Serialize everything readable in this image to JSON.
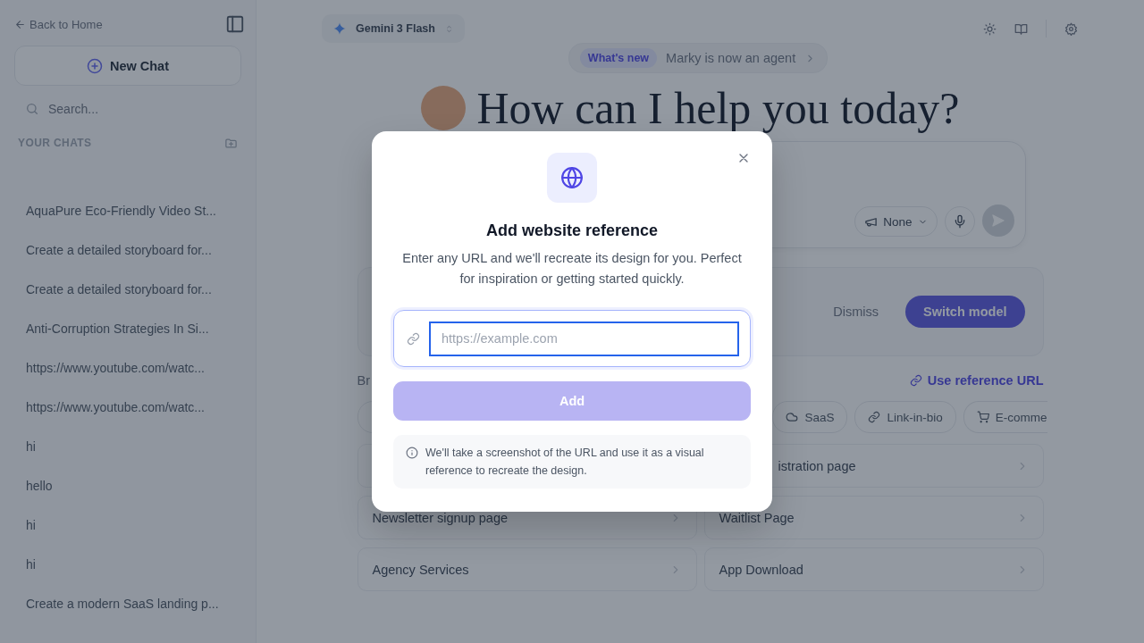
{
  "sidebar": {
    "back_link": "Back to Home",
    "new_chat": "New Chat",
    "search": {
      "placeholder": "Search..."
    },
    "section_title": "YOUR CHATS",
    "chats": [
      "AquaPure Eco-Friendly Video St...",
      "Create a detailed storyboard for...",
      "Create a detailed storyboard for...",
      "Anti-Corruption Strategies In Si...",
      "https://www.youtube.com/watc...",
      "https://www.youtube.com/watc...",
      "hi",
      "hello",
      "hi",
      "hi",
      "Create a modern SaaS landing p..."
    ]
  },
  "top_bar": {
    "model": "Gemini 3 Flash"
  },
  "announcement": {
    "badge": "What's new",
    "text": "Marky is now an agent"
  },
  "heading": "How can I help you today?",
  "prompt": {
    "style_select": "None"
  },
  "model_banner": {
    "dismiss": "Dismiss",
    "switch": "Switch model"
  },
  "section_label": "Br",
  "reference_link": "Use reference URL",
  "categories": [
    {
      "kind": "cloud",
      "label": "SaaS"
    },
    {
      "kind": "link",
      "label": "Link-in-bio"
    },
    {
      "kind": "cart",
      "label": "E-comme"
    }
  ],
  "templates": [
    "istration page",
    "Newsletter signup page",
    "Waitlist Page",
    "Agency Services",
    "App Download"
  ],
  "modal": {
    "title": "Add website reference",
    "description": "Enter any URL and we'll recreate its design for you. Perfect for inspiration or getting started quickly.",
    "url_field": {
      "placeholder": "https://example.com"
    },
    "add_button": {
      "label": "Add",
      "disabled": true
    },
    "note": "We'll take a screenshot of the URL and use it as a visual reference to recreate the design."
  }
}
